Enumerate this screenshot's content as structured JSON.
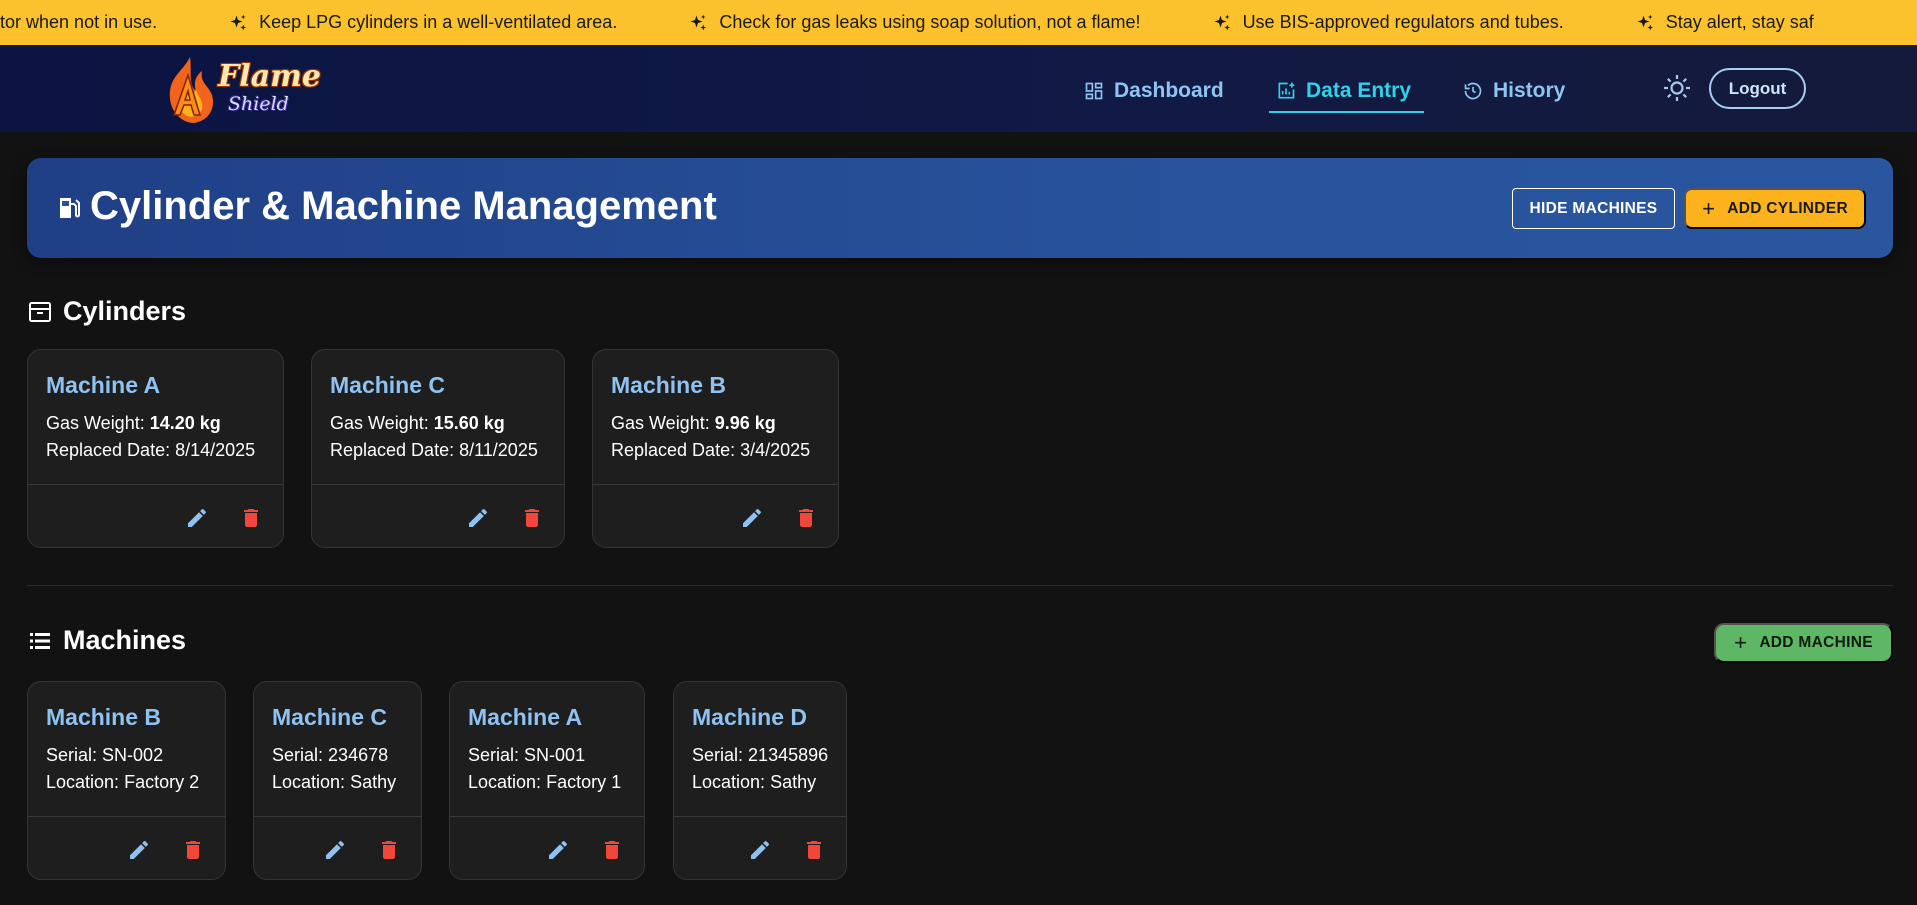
{
  "ticker": {
    "items": [
      "ulator when not in use.",
      "Keep LPG cylinders in a well-ventilated area.",
      "Check for gas leaks using soap solution, not a flame!",
      "Use BIS-approved regulators and tubes.",
      "Stay alert, stay saf"
    ]
  },
  "brand": {
    "line1": "Flame",
    "line2": "Shield"
  },
  "nav": {
    "dashboard": "Dashboard",
    "data_entry": "Data Entry",
    "history": "History",
    "active": "Data Entry",
    "logout": "Logout"
  },
  "banner": {
    "title": "Cylinder & Machine Management",
    "hide_machines": "HIDE MACHINES",
    "add_cylinder": "ADD CYLINDER"
  },
  "cylinders": {
    "heading": "Cylinders",
    "weight_label": "Gas Weight:",
    "date_label": "Replaced Date:",
    "items": [
      {
        "name": "Machine A",
        "weight": "14.20 kg",
        "date": "8/14/2025"
      },
      {
        "name": "Machine C",
        "weight": "15.60 kg",
        "date": "8/11/2025"
      },
      {
        "name": "Machine B",
        "weight": "9.96 kg",
        "date": "3/4/2025"
      }
    ]
  },
  "machines": {
    "heading": "Machines",
    "add_machine": "ADD MACHINE",
    "serial_label": "Serial:",
    "location_label": "Location:",
    "items": [
      {
        "name": "Machine B",
        "serial": "SN-002",
        "location": "Factory 2"
      },
      {
        "name": "Machine C",
        "serial": "234678",
        "location": "Sathy"
      },
      {
        "name": "Machine A",
        "serial": "SN-001",
        "location": "Factory 1"
      },
      {
        "name": "Machine D",
        "serial": "21345896",
        "location": "Sathy"
      }
    ]
  },
  "colors": {
    "ticker_bg": "#fbc22d",
    "accent_active": "#2fd3e9",
    "link": "#8fc4f2",
    "add_cylinder": "#fbb21c",
    "add_machine": "#5db764",
    "delete": "#f1473b"
  },
  "icons": {
    "ticker": "sparkles-icon",
    "dashboard": "grid-icon",
    "data_entry": "chart-add-icon",
    "history": "history-icon",
    "theme": "sun-icon",
    "banner": "fuel-pump-icon",
    "cylinders": "archive-box-icon",
    "machines": "list-icon",
    "edit": "pencil-icon",
    "delete": "trash-icon"
  }
}
